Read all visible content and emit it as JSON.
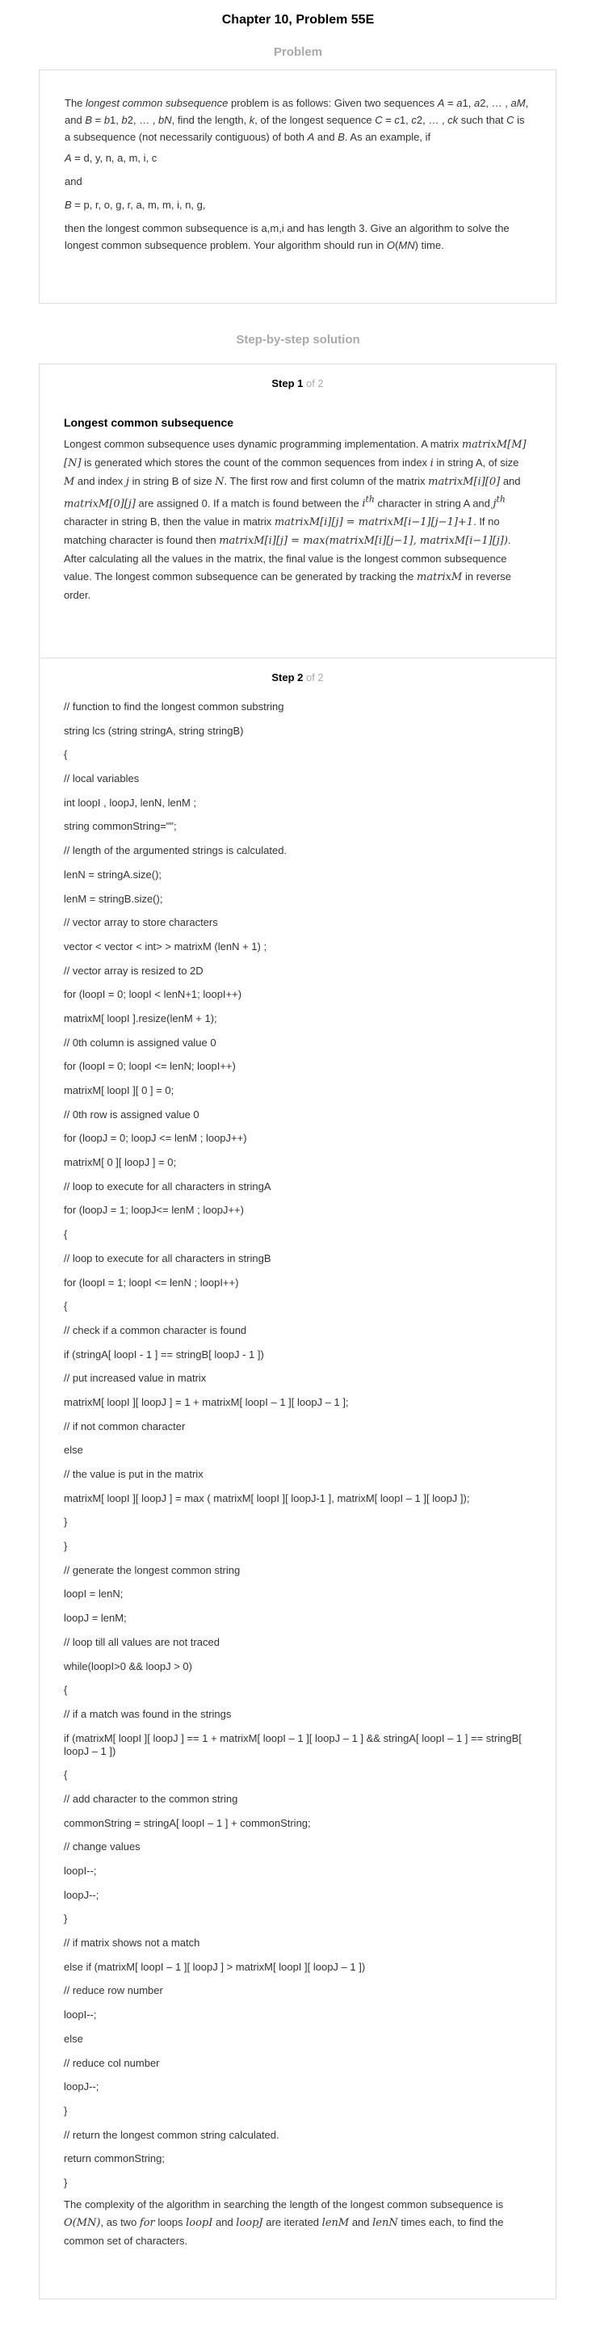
{
  "page": {
    "title": "Chapter 10, Problem 55E"
  },
  "problem": {
    "heading": "Problem",
    "intro": {
      "p1": "The ",
      "p2": "longest common subsequence",
      "p3": " problem is as follows: Given two sequences ",
      "p4": "A",
      "p5": " = ",
      "p6": "a",
      "p7": "1, ",
      "p8": "a",
      "p9": "2, … , ",
      "p10": "aM",
      "p11": ", and ",
      "p12": "B",
      "p13": " = ",
      "p14": "b",
      "p15": "1, ",
      "p16": "b",
      "p17": "2, … , ",
      "p18": "bN",
      "p19": ", find the length, ",
      "p20": "k",
      "p21": ", of the longest sequence ",
      "p22": "C",
      "p23": " = ",
      "p24": "c",
      "p25": "1, ",
      "p26": "c",
      "p27": "2, … , ",
      "p28": "ck",
      "p29": " such that ",
      "p30": "C",
      "p31": " is a subsequence (not necessarily contiguous) of both ",
      "p32": "A",
      "p33": " and ",
      "p34": "B",
      "p35": ". As an example, if"
    },
    "line_a": {
      "var": "A",
      "rest": " = d, y, n, a, m, i, c"
    },
    "and_text": "and",
    "line_b": {
      "var": "B",
      "rest": " = p, r, o, g, r, a, m, m, i, n, g,"
    },
    "conclusion": {
      "p1": "then the longest common subsequence is a,m,i and has length 3. Give an algorithm to solve the longest common subsequence problem. Your algorithm should run in ",
      "p2": "O",
      "p3": "(",
      "p4": "MN",
      "p5": ") time."
    }
  },
  "solution": {
    "heading": "Step-by-step solution",
    "step1": {
      "label": "Step 1",
      "of": " of 2",
      "title": "Longest common subsequence",
      "body": {
        "t1": "Longest common subsequence uses dynamic programming implementation. A matrix ",
        "m1": "matrixM[M][N]",
        "t2": " is generated which stores the count of the common sequences from index ",
        "m2": "i",
        "t3": " in string A, of size ",
        "m3": "M",
        "t4": " and index ",
        "m4": "j",
        "t5": " in string B of size ",
        "m5": "N",
        "t6": ". The first row and first column of the matrix ",
        "m6": "matrixM[i][0]",
        "t7": " and ",
        "m7": "matrixM[0][j]",
        "t8": " are assigned 0. If a match is found between the ",
        "m8a": "i",
        "m8b": "th",
        "t9": " character in string A and ",
        "m9a": "j",
        "m9b": "th",
        "t10": " character in string B, then the value in matrix ",
        "m10": "matrixM[i][j] = matrixM[i−1][j−1]+1",
        "t11": ". If no matching character is found then ",
        "m11": "matrixM[i][j] = max(matrixM[i][j−1], matrixM[i−1][j])",
        "t12": ". After calculating all the values in the matrix, the final value is the longest common subsequence value. The longest common subsequence can be generated by tracking the ",
        "m12": "matrixM",
        "t13": " in reverse order."
      }
    },
    "step2": {
      "label": "Step 2",
      "of": " of 2",
      "code_lines": [
        "// function to find the longest common substring",
        "string lcs (string stringA, string stringB)",
        "{",
        "// local variables",
        "int loopI , loopJ, lenN, lenM ;",
        "string commonString=\"\";",
        "// length of the argumented strings is calculated.",
        "lenN = stringA.size();",
        "lenM = stringB.size();",
        "// vector array to store characters",
        "vector < vector < int> > matrixM (lenN + 1) ;",
        "// vector array is resized to 2D",
        "for (loopI = 0; loopI < lenN+1; loopI++)",
        "matrixM[ loopI ].resize(lenM + 1);",
        "// 0th column is assigned value 0",
        "for (loopI = 0; loopI <= lenN; loopI++)",
        "matrixM[ loopI ][ 0 ] = 0;",
        "// 0th row is assigned value 0",
        "for (loopJ = 0; loopJ <= lenM ; loopJ++)",
        "matrixM[ 0 ][ loopJ ] = 0;",
        "// loop to execute for all characters in stringA",
        "for (loopJ = 1; loopJ<= lenM ; loopJ++)",
        "{",
        "// loop to execute for all characters in stringB",
        "for (loopI = 1; loopI <= lenN ; loopI++)",
        "{",
        "// check if a common character is found",
        "if (stringA[ loopI - 1 ] == stringB[ loopJ - 1 ])",
        "// put increased value in matrix",
        "matrixM[ loopI ][ loopJ ] = 1 + matrixM[ loopI – 1 ][ loopJ – 1 ];",
        "// if not common character",
        "else",
        "// the value is put in the matrix",
        "matrixM[ loopI ][ loopJ ] = max ( matrixM[ loopI ][ loopJ-1 ], matrixM[ loopI – 1 ][ loopJ ]);",
        "}",
        "}",
        "// generate the longest common string",
        "loopI = lenN;",
        "loopJ = lenM;",
        "// loop till all values are not traced",
        "while(loopI>0 && loopJ > 0)",
        "{",
        "// if a match was found in the strings",
        "if (matrixM[ loopI ][ loopJ ] == 1 + matrixM[ loopI – 1 ][ loopJ – 1 ] && stringA[ loopI – 1 ] == stringB[ loopJ – 1 ])",
        "{",
        "// add character to the common string",
        "commonString = stringA[ loopI – 1 ] + commonString;",
        "// change values",
        "loopI--;",
        "loopJ--;",
        "}",
        "// if matrix shows not a match",
        "else if (matrixM[ loopI – 1 ][ loopJ ] > matrixM[ loopI ][ loopJ – 1 ])",
        "// reduce row number",
        "loopI--;",
        "else",
        "// reduce col number",
        "loopJ--;",
        "}",
        "// return the longest common string calculated.",
        "return commonString;",
        "}"
      ],
      "closing": {
        "t1": "The complexity of the algorithm in searching the length of the longest common subsequence is ",
        "m1": "O(MN)",
        "t2": ", as two ",
        "m2": "for",
        "t3": " loops ",
        "m3": "loopI",
        "t4": " and ",
        "m4": "loopJ",
        "t5": " are iterated ",
        "m5": "lenM",
        "t6": " and ",
        "m6": "lenN",
        "t7": " times each, to find the common set of characters."
      }
    }
  }
}
